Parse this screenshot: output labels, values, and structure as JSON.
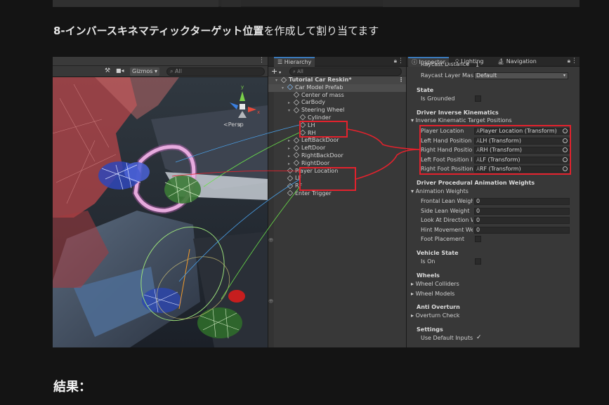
{
  "heading": {
    "prefix": "8-",
    "bold": "インバースキネマティックターゲット位置",
    "suffix": "を作成して割り当てます"
  },
  "footer_heading": "結果：",
  "scene": {
    "gizmos_label": "Gizmos",
    "search_placeholder": "All",
    "persp_label": "<Persp",
    "axis_y": "y",
    "axis_x": "x",
    "axis_z": "z"
  },
  "hierarchy": {
    "tab": "Hierarchy",
    "add_label": "+",
    "search_placeholder": "All",
    "rows": [
      {
        "label": "Tutorial Car Reskin*",
        "type": "scene"
      },
      {
        "label": "Car Model Prefab",
        "type": "prefab"
      },
      {
        "label": "Center of mass",
        "type": "obj"
      },
      {
        "label": "CarBody",
        "type": "obj"
      },
      {
        "label": "Steering Wheel",
        "type": "obj"
      },
      {
        "label": "Cylinder",
        "type": "obj"
      },
      {
        "label": "LH",
        "type": "obj"
      },
      {
        "label": "RH",
        "type": "obj"
      },
      {
        "label": "LeftBackDoor",
        "type": "obj"
      },
      {
        "label": "LeftDoor",
        "type": "obj"
      },
      {
        "label": "RightBackDoor",
        "type": "obj"
      },
      {
        "label": "RightDoor",
        "type": "obj"
      },
      {
        "label": "Player Location",
        "type": "obj"
      },
      {
        "label": "LF",
        "type": "obj"
      },
      {
        "label": "RF",
        "type": "obj"
      },
      {
        "label": "Enter Trigger",
        "type": "obj"
      }
    ]
  },
  "inspector": {
    "tabs": [
      "Inspector",
      "Lighting",
      "Navigation"
    ],
    "raycast_distance_label": "Raycast Distance",
    "raycast_distance_value": "1",
    "raycast_layer_label": "Raycast Layer Mas",
    "raycast_layer_value": "Default",
    "state_header": "State",
    "is_grounded_label": "Is Grounded",
    "dik_header": "Driver Inverse Kinematics",
    "ik_targets_label": "Inverse Kinematic Target Positions",
    "ik_fields": [
      {
        "label": "Player Location",
        "value": "Player Location (Transform)"
      },
      {
        "label": "Left Hand Position",
        "value": "LH (Transform)"
      },
      {
        "label": "Right Hand Position",
        "value": "RH (Transform)"
      },
      {
        "label": "Left Foot Position II",
        "value": "LF (Transform)"
      },
      {
        "label": "Right Foot Position",
        "value": "RF (Transform)"
      }
    ],
    "dpa_header": "Driver Procedural Animation Weights",
    "anim_weights_label": "Animation Weights",
    "weights": [
      {
        "label": "Frontal Lean Weigh",
        "value": "0"
      },
      {
        "label": "Side Lean Weight",
        "value": "0"
      },
      {
        "label": "Look At Direction W",
        "value": "0"
      },
      {
        "label": "Hint Movement We",
        "value": "0"
      }
    ],
    "foot_placement_label": "Foot Placement",
    "vehicle_state_header": "Vehicle State",
    "is_on_label": "Is On",
    "wheels_header": "Wheels",
    "wheel_colliders_label": "Wheel Colliders",
    "wheel_models_label": "Wheel Models",
    "anti_overturn_header": "Anti Overturn",
    "overturn_check_label": "Overturn Check",
    "settings_header": "Settings",
    "use_default_inputs_label": "Use Default Inputs",
    "check_glyph": "✓"
  }
}
